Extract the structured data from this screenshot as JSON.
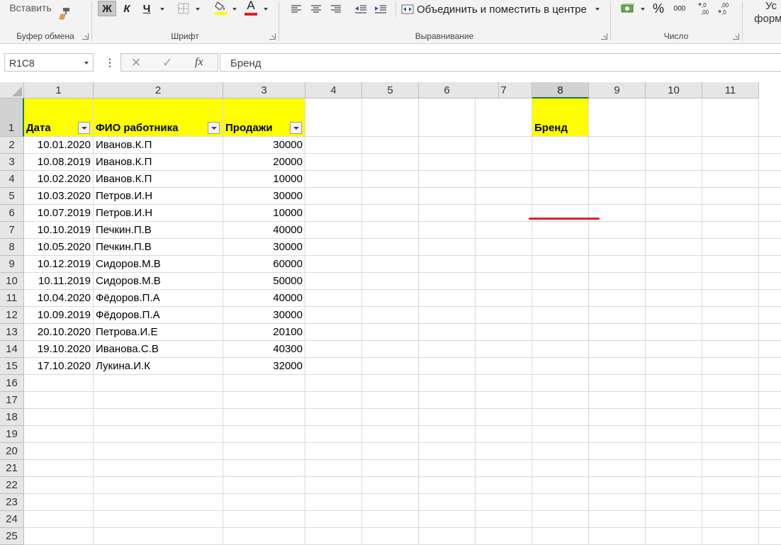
{
  "ribbon": {
    "clipboard": {
      "paste_label": "Вставить",
      "group_label": "Буфер обмена"
    },
    "font": {
      "bold_label": "Ж",
      "italic_label": "К",
      "underline_label": "Ч",
      "font_color_letter": "A",
      "group_label": "Шрифт"
    },
    "alignment": {
      "merge_label": "Объединить и поместить в центре",
      "group_label": "Выравнивание"
    },
    "number": {
      "percent_label": "%",
      "thousands_label": "000",
      "group_label": "Число"
    },
    "styles": {
      "conditional_label_line1": "Ус",
      "conditional_label_line2": "форма"
    }
  },
  "formula_bar": {
    "name_box": "R1C8",
    "function_symbol": "fx",
    "content": "Бренд"
  },
  "sheet": {
    "column_headers": [
      "1",
      "2",
      "3",
      "4",
      "5",
      "6",
      "7",
      "8",
      "9",
      "10",
      "11"
    ],
    "row_headers": [
      "1",
      "2",
      "3",
      "4",
      "5",
      "6",
      "7",
      "8",
      "9",
      "10",
      "11",
      "12",
      "13",
      "14",
      "15",
      "16",
      "17",
      "18",
      "19",
      "20",
      "21",
      "22",
      "23",
      "24",
      "25"
    ],
    "table_headers": [
      "Дата",
      "ФИО работника",
      "Продажи"
    ],
    "brand_header": "Бренд",
    "rows": [
      [
        "10.01.2020",
        "Иванов.К.П",
        "30000"
      ],
      [
        "10.08.2019",
        "Иванов.К.П",
        "20000"
      ],
      [
        "10.02.2020",
        "Иванов.К.П",
        "10000"
      ],
      [
        "10.03.2020",
        "Петров.И.Н",
        "30000"
      ],
      [
        "10.07.2019",
        "Петров.И.Н",
        "10000"
      ],
      [
        "10.10.2019",
        "Печкин.П.В",
        "40000"
      ],
      [
        "10.05.2020",
        "Печкин.П.В",
        "30000"
      ],
      [
        "10.12.2019",
        "Сидоров.М.В",
        "60000"
      ],
      [
        "10.11.2019",
        "Сидоров.М.В",
        "50000"
      ],
      [
        "10.04.2020",
        "Фёдоров.П.А",
        "40000"
      ],
      [
        "10.09.2019",
        "Фёдоров.П.А",
        "30000"
      ],
      [
        "20.10.2020",
        "Петрова.И.Е",
        "20100"
      ],
      [
        "19.10.2020",
        "Иванова.С.В",
        "40300"
      ],
      [
        "17.10.2020",
        "Лукина.И.К",
        "32000"
      ]
    ],
    "selected_cell": "R1C8",
    "colors": {
      "header_fill": "#ffff00",
      "annotation_underline": "#d8232a",
      "selection_accent": "#217346"
    }
  }
}
